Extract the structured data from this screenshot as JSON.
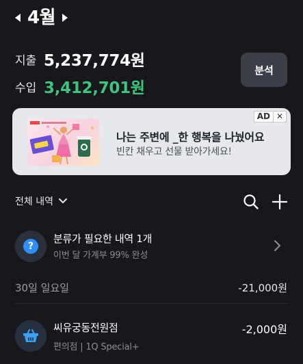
{
  "header": {
    "month": "4월",
    "prev_icon": "caret-left-icon",
    "next_icon": "caret-right-icon"
  },
  "summary": {
    "expense_label": "지출",
    "expense_amount": "5,237,774원",
    "income_label": "수입",
    "income_amount": "3,412,701원",
    "income_color": "#3fc47f",
    "analyze_label": "분석"
  },
  "ad": {
    "badge": "AD",
    "close": "✕",
    "title": "나는 주변에 _한 행복을 나눴어요",
    "subtitle": "빈칸 채우고 선물 받아가세요!"
  },
  "list_header": {
    "filter_label": "전체 내역",
    "filter_icon": "chevron-down-icon",
    "search_icon": "search-icon",
    "add_icon": "plus-icon"
  },
  "uncategorized": {
    "icon": "question-icon",
    "title": "분류가 필요한 내역 1개",
    "subtitle": "이번 달 가계부 99% 완성",
    "accent": "#2f8ff5"
  },
  "days": [
    {
      "date": "30일 일요일",
      "total": "-21,000원",
      "transactions": [
        {
          "icon": "shopping-basket-icon",
          "name": "씨유궁동전원점",
          "meta": "편의점 | 1Q Special+",
          "amount": "-2,000원"
        }
      ]
    }
  ]
}
